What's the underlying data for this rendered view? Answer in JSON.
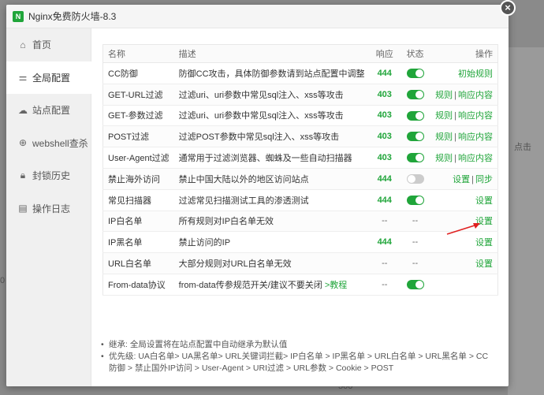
{
  "window": {
    "title": "Nginx免费防火墙-8.3"
  },
  "sidebar": {
    "items": [
      {
        "label": "首页",
        "icon": "home-icon"
      },
      {
        "label": "全局配置",
        "icon": "sliders-icon"
      },
      {
        "label": "站点配置",
        "icon": "cloud-icon"
      },
      {
        "label": "webshell查杀",
        "icon": "target-icon"
      },
      {
        "label": "封锁历史",
        "icon": "lock-icon"
      },
      {
        "label": "操作日志",
        "icon": "document-icon"
      }
    ],
    "active": 1
  },
  "table": {
    "headers": {
      "name": "名称",
      "desc": "描述",
      "code": "响应",
      "status": "状态",
      "op": "操作"
    },
    "rows": [
      {
        "name": "CC防御",
        "desc": "防御CC攻击，具体防御参数请到站点配置中调整",
        "code": "444",
        "status": "on",
        "ops": [
          "初始规则"
        ]
      },
      {
        "name": "GET-URL过滤",
        "desc": "过滤uri、uri参数中常见sql注入、xss等攻击",
        "code": "403",
        "status": "on",
        "ops": [
          "规则",
          "响应内容"
        ]
      },
      {
        "name": "GET-参数过滤",
        "desc": "过滤uri、uri参数中常见sql注入、xss等攻击",
        "code": "403",
        "status": "on",
        "ops": [
          "规则",
          "响应内容"
        ]
      },
      {
        "name": "POST过滤",
        "desc": "过滤POST参数中常见sql注入、xss等攻击",
        "code": "403",
        "status": "on",
        "ops": [
          "规则",
          "响应内容"
        ]
      },
      {
        "name": "User-Agent过滤",
        "desc": "通常用于过滤浏览器、蜘蛛及一些自动扫描器",
        "code": "403",
        "status": "on",
        "ops": [
          "规则",
          "响应内容"
        ]
      },
      {
        "name": "禁止海外访问",
        "desc": "禁止中国大陆以外的地区访问站点",
        "code": "444",
        "status": "off",
        "ops": [
          "设置",
          "同步"
        ]
      },
      {
        "name": "常见扫描器",
        "desc": "过滤常见扫描测试工具的渗透测试",
        "code": "444",
        "status": "on",
        "ops": [
          "设置"
        ]
      },
      {
        "name": "IP白名单",
        "desc": "所有规则对IP白名单无效",
        "code": "--",
        "status": "--",
        "ops": [
          "设置"
        ]
      },
      {
        "name": "IP黑名单",
        "desc": "禁止访问的IP",
        "code": "444",
        "status": "--",
        "ops": [
          "设置"
        ]
      },
      {
        "name": "URL白名单",
        "desc": "大部分规则对URL白名单无效",
        "code": "--",
        "status": "--",
        "ops": [
          "设置"
        ]
      },
      {
        "name": "From-data协议",
        "desc": "from-data传参规范开关/建议不要关闭",
        "desc_link": ">教程",
        "code": "--",
        "status": "on",
        "ops": []
      }
    ]
  },
  "notes": [
    "继承: 全局设置将在站点配置中自动继承为默认值",
    "优先级: UA白名单> UA黑名单> URL关键词拦截> IP白名单 > IP黑名单 > URL白名单 > URL黑名单 > CC防御 > 禁止国外IP访问 > User-Agent > URI过滤 > URL参数 > Cookie > POST"
  ],
  "background": {
    "text1": "点击",
    "text2": "500",
    "text3": "0"
  },
  "colors": {
    "accent": "#20a53a",
    "arrow": "#e02020"
  }
}
